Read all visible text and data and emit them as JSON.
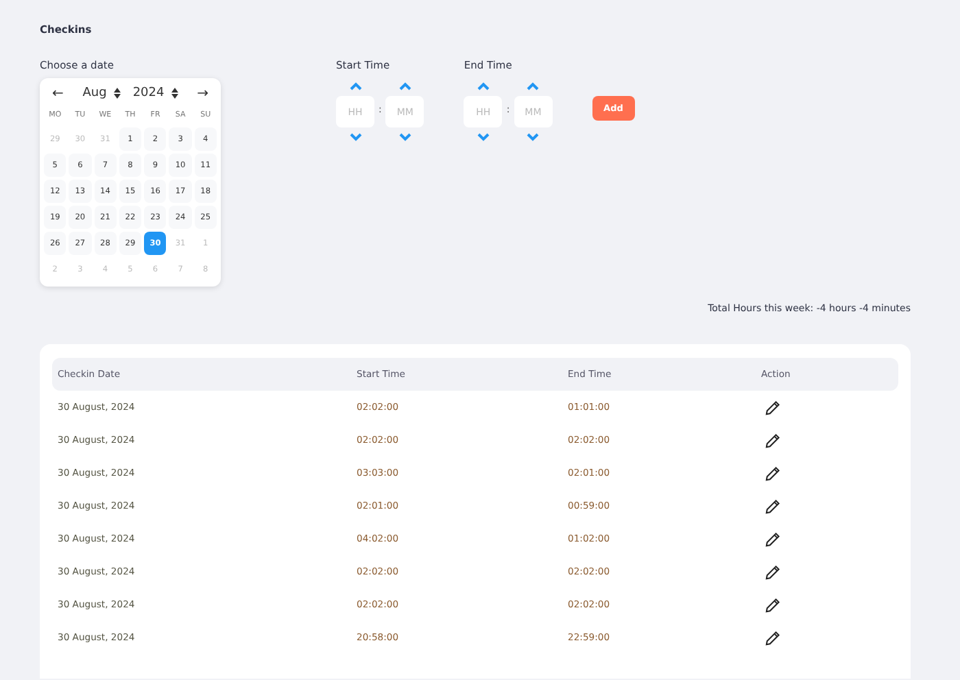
{
  "page_title": "Checkins",
  "date_picker": {
    "label": "Choose a date",
    "prev": "←",
    "next": "→",
    "month": "Aug",
    "year": "2024",
    "weekdays": [
      "MO",
      "TU",
      "WE",
      "TH",
      "FR",
      "SA",
      "SU"
    ],
    "days": [
      {
        "text": "29",
        "muted": true,
        "selected": false
      },
      {
        "text": "30",
        "muted": true,
        "selected": false
      },
      {
        "text": "31",
        "muted": true,
        "selected": false
      },
      {
        "text": "1",
        "muted": false,
        "selected": false
      },
      {
        "text": "2",
        "muted": false,
        "selected": false
      },
      {
        "text": "3",
        "muted": false,
        "selected": false
      },
      {
        "text": "4",
        "muted": false,
        "selected": false
      },
      {
        "text": "5",
        "muted": false,
        "selected": false
      },
      {
        "text": "6",
        "muted": false,
        "selected": false
      },
      {
        "text": "7",
        "muted": false,
        "selected": false
      },
      {
        "text": "8",
        "muted": false,
        "selected": false
      },
      {
        "text": "9",
        "muted": false,
        "selected": false
      },
      {
        "text": "10",
        "muted": false,
        "selected": false
      },
      {
        "text": "11",
        "muted": false,
        "selected": false
      },
      {
        "text": "12",
        "muted": false,
        "selected": false
      },
      {
        "text": "13",
        "muted": false,
        "selected": false
      },
      {
        "text": "14",
        "muted": false,
        "selected": false
      },
      {
        "text": "15",
        "muted": false,
        "selected": false
      },
      {
        "text": "16",
        "muted": false,
        "selected": false
      },
      {
        "text": "17",
        "muted": false,
        "selected": false
      },
      {
        "text": "18",
        "muted": false,
        "selected": false
      },
      {
        "text": "19",
        "muted": false,
        "selected": false
      },
      {
        "text": "20",
        "muted": false,
        "selected": false
      },
      {
        "text": "21",
        "muted": false,
        "selected": false
      },
      {
        "text": "22",
        "muted": false,
        "selected": false
      },
      {
        "text": "23",
        "muted": false,
        "selected": false
      },
      {
        "text": "24",
        "muted": false,
        "selected": false
      },
      {
        "text": "25",
        "muted": false,
        "selected": false
      },
      {
        "text": "26",
        "muted": false,
        "selected": false
      },
      {
        "text": "27",
        "muted": false,
        "selected": false
      },
      {
        "text": "28",
        "muted": false,
        "selected": false
      },
      {
        "text": "29",
        "muted": false,
        "selected": false
      },
      {
        "text": "30",
        "muted": false,
        "selected": true
      },
      {
        "text": "31",
        "muted": true,
        "selected": false
      },
      {
        "text": "1",
        "muted": true,
        "selected": false
      },
      {
        "text": "2",
        "muted": true,
        "selected": false
      },
      {
        "text": "3",
        "muted": true,
        "selected": false
      },
      {
        "text": "4",
        "muted": true,
        "selected": false
      },
      {
        "text": "5",
        "muted": true,
        "selected": false
      },
      {
        "text": "6",
        "muted": true,
        "selected": false
      },
      {
        "text": "7",
        "muted": true,
        "selected": false
      },
      {
        "text": "8",
        "muted": true,
        "selected": false
      }
    ]
  },
  "time_pickers": [
    {
      "label": "Start Time",
      "separator": ":",
      "hour": {
        "placeholder": "HH"
      },
      "minute": {
        "placeholder": "MM"
      }
    },
    {
      "label": "End Time",
      "separator": ":",
      "hour": {
        "placeholder": "HH"
      },
      "minute": {
        "placeholder": "MM"
      }
    }
  ],
  "add_button": "Add",
  "total_hours": "Total Hours this week: -4 hours -4 minutes",
  "table": {
    "columns": [
      "Checkin Date",
      "Start Time",
      "End Time",
      "Action"
    ],
    "rows": [
      {
        "date": "30 August, 2024",
        "start": "02:02:00",
        "end": "01:01:00"
      },
      {
        "date": "30 August, 2024",
        "start": "02:02:00",
        "end": "02:02:00"
      },
      {
        "date": "30 August, 2024",
        "start": "03:03:00",
        "end": "02:01:00"
      },
      {
        "date": "30 August, 2024",
        "start": "02:01:00",
        "end": "00:59:00"
      },
      {
        "date": "30 August, 2024",
        "start": "04:02:00",
        "end": "01:02:00"
      },
      {
        "date": "30 August, 2024",
        "start": "02:02:00",
        "end": "02:02:00"
      },
      {
        "date": "30 August, 2024",
        "start": "02:02:00",
        "end": "02:02:00"
      },
      {
        "date": "30 August, 2024",
        "start": "20:58:00",
        "end": "22:59:00"
      }
    ]
  }
}
